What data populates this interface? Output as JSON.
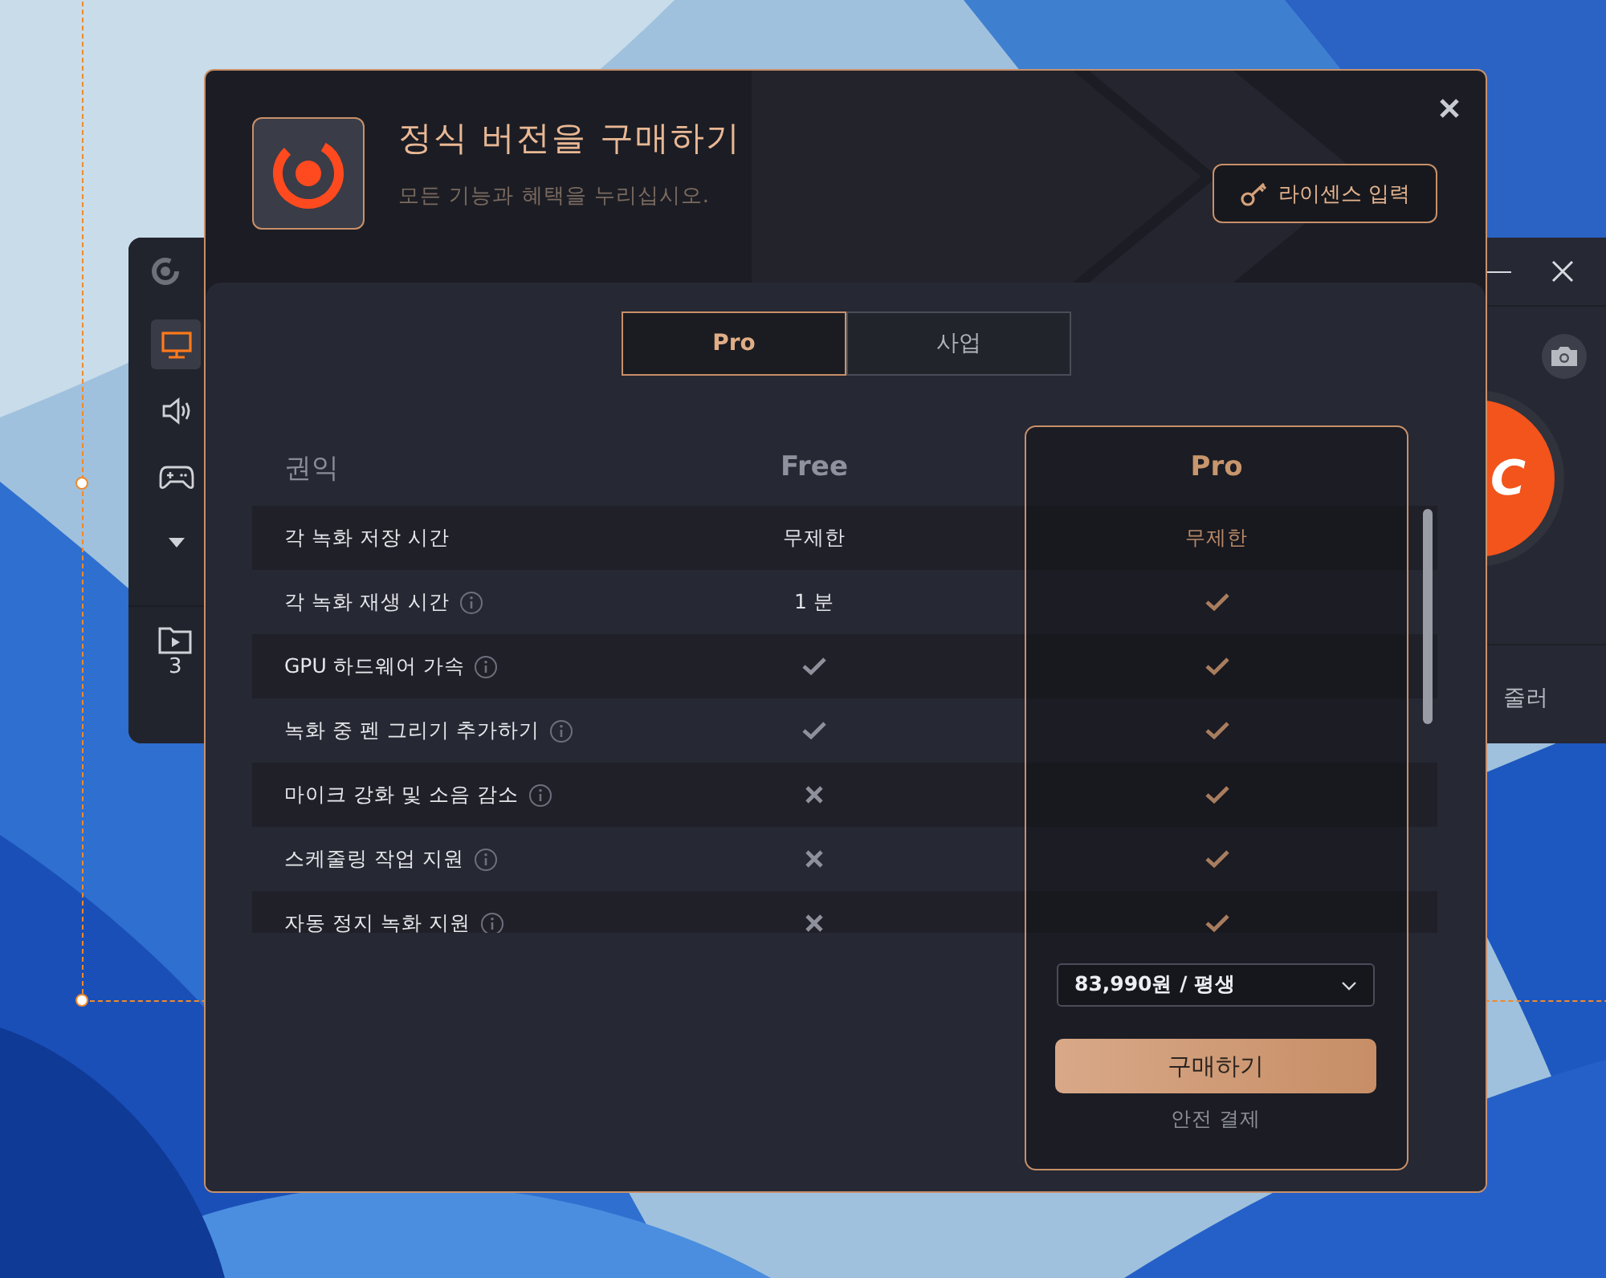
{
  "background_app": {
    "sidebar": {
      "items": [
        {
          "kind": "monitor",
          "selected": true
        },
        {
          "kind": "speaker",
          "selected": false
        },
        {
          "kind": "gamepad",
          "selected": false
        },
        {
          "kind": "more",
          "selected": false
        }
      ],
      "folder_count": "3"
    },
    "record_button_text": "C",
    "bottom_label": "줄러"
  },
  "dialog": {
    "title": "정식 버전을 구매하기",
    "subtitle": "모든 기능과 혜택을 누리십시오.",
    "license_button": "라이센스 입력",
    "tabs": [
      {
        "label": "Pro",
        "selected": true
      },
      {
        "label": "사업",
        "selected": false
      }
    ],
    "table": {
      "columns": [
        "권익",
        "Free",
        "Pro"
      ],
      "rows": [
        {
          "feature": "각 녹화 저장 시간",
          "info": false,
          "free": {
            "kind": "text",
            "text": "무제한"
          },
          "pro": {
            "kind": "text",
            "text": "무제한"
          }
        },
        {
          "feature": "각 녹화 재생 시간",
          "info": true,
          "free": {
            "kind": "text",
            "text": "1 분"
          },
          "pro": {
            "kind": "check"
          }
        },
        {
          "feature": "GPU 하드웨어 가속",
          "info": true,
          "free": {
            "kind": "check"
          },
          "pro": {
            "kind": "check"
          }
        },
        {
          "feature": "녹화 중 펜 그리기 추가하기",
          "info": true,
          "free": {
            "kind": "check"
          },
          "pro": {
            "kind": "check"
          }
        },
        {
          "feature": "마이크 강화 및 소음 감소",
          "info": true,
          "free": {
            "kind": "cross"
          },
          "pro": {
            "kind": "check"
          }
        },
        {
          "feature": "스케줄링 작업 지원",
          "info": true,
          "free": {
            "kind": "cross"
          },
          "pro": {
            "kind": "check"
          }
        },
        {
          "feature": "자동 정지 녹화 지원",
          "info": true,
          "free": {
            "kind": "cross"
          },
          "pro": {
            "kind": "check"
          }
        }
      ]
    },
    "price_select": {
      "value": "83,990원 / 평생"
    },
    "buy_button": "구매하기",
    "note": "안전 결제"
  }
}
